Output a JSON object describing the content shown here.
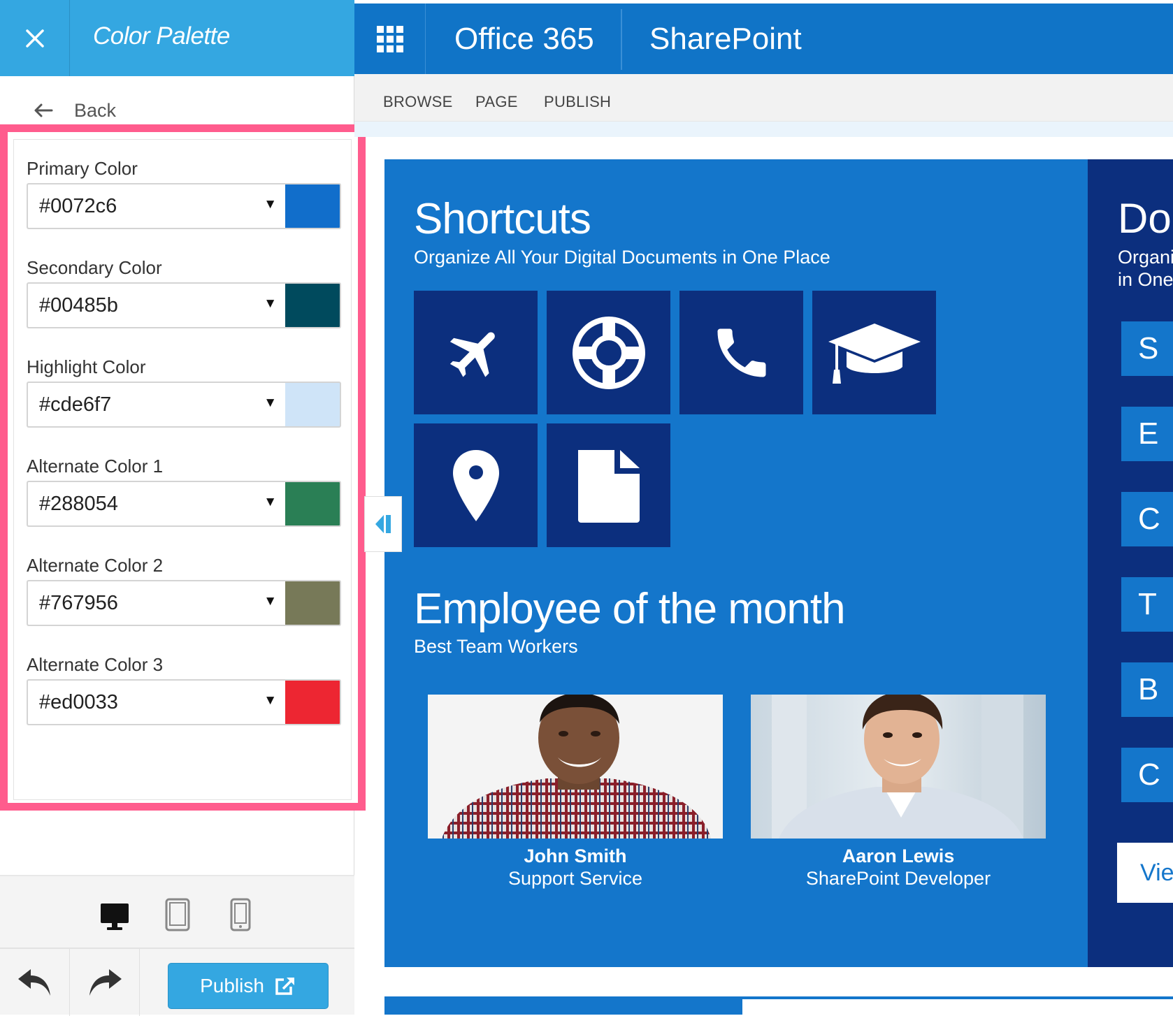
{
  "panel": {
    "title": "Color Palette",
    "back_label": "Back",
    "colors": [
      {
        "label": "Primary Color",
        "value": "#0072c6",
        "swatch": "#116ecb"
      },
      {
        "label": "Secondary Color",
        "value": "#00485b",
        "swatch": "#004a5d"
      },
      {
        "label": "Highlight Color",
        "value": "#cde6f7",
        "swatch": "#cfe4f8"
      },
      {
        "label": "Alternate Color 1",
        "value": "#288054",
        "swatch": "#2a7f55"
      },
      {
        "label": "Alternate Color 2",
        "value": "#767956",
        "swatch": "#777958"
      },
      {
        "label": "Alternate Color 3",
        "value": "#ed0033",
        "swatch": "#ed2632"
      }
    ],
    "publish_label": "Publish",
    "highlight_border": "#ff5c8d",
    "accent": "#34a7e1"
  },
  "topbar": {
    "app_title": "Office 365",
    "site_title": "SharePoint"
  },
  "ribbon": {
    "tabs": [
      "BROWSE",
      "PAGE",
      "PUBLISH"
    ]
  },
  "shortcuts": {
    "title": "Shortcuts",
    "subtitle": "Organize All Your Digital Documents in One Place",
    "tiles": [
      "airplane-icon",
      "lifebuoy-icon",
      "phone-icon",
      "graduation-cap-icon",
      "map-pin-icon",
      "document-icon"
    ]
  },
  "employees": {
    "title": "Employee of the month",
    "subtitle": "Best Team Workers",
    "people": [
      {
        "name": "John Smith",
        "role": "Support Service"
      },
      {
        "name": "Aaron Lewis",
        "role": "SharePoint Developer"
      }
    ]
  },
  "side": {
    "title": "Doc",
    "subtitle_line1": "Organiz",
    "subtitle_line2": "in One",
    "letters": [
      "S",
      "E",
      "C",
      "T",
      "B",
      "C"
    ],
    "view_label": "Vie"
  }
}
